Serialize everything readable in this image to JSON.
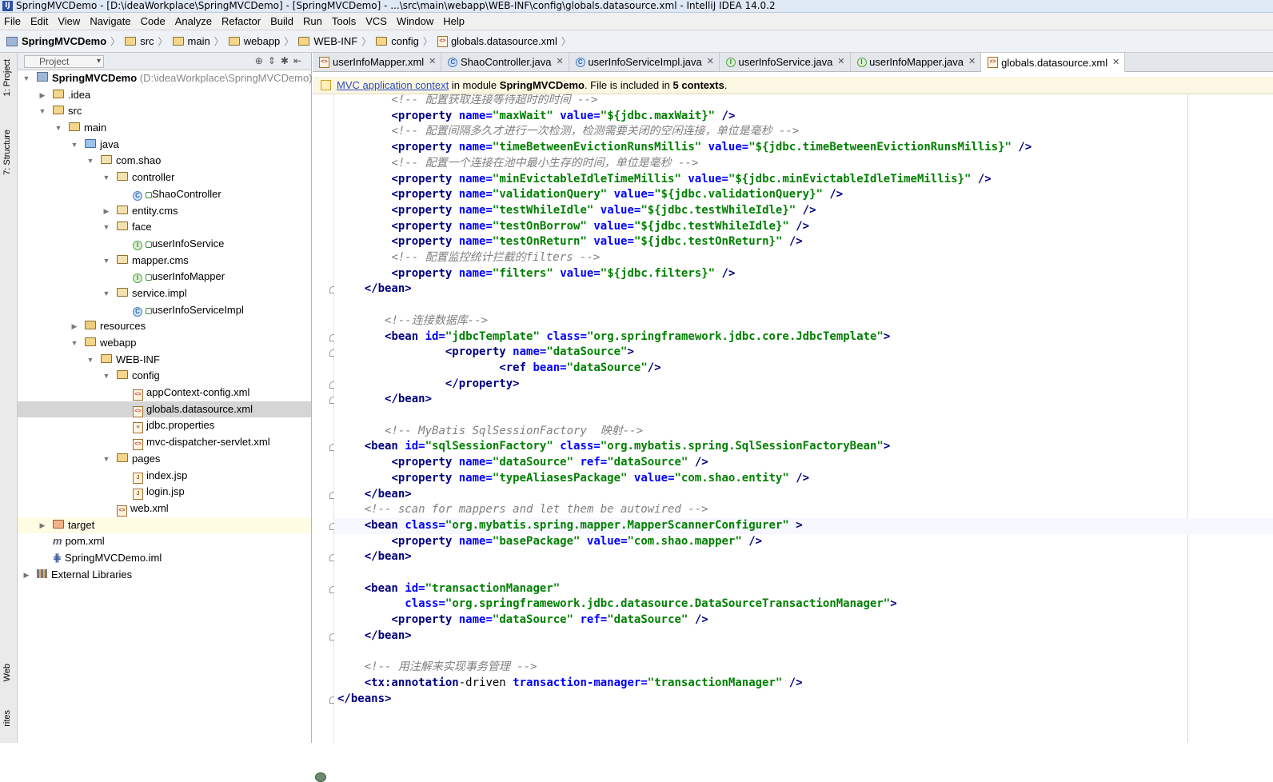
{
  "window": {
    "title": "SpringMVCDemo - [D:\\ideaWorkplace\\SpringMVCDemo] - [SpringMVCDemo] - ...\\src\\main\\webapp\\WEB-INF\\config\\globals.datasource.xml - IntelliJ IDEA 14.0.2"
  },
  "menu": [
    "File",
    "Edit",
    "View",
    "Navigate",
    "Code",
    "Analyze",
    "Refactor",
    "Build",
    "Run",
    "Tools",
    "VCS",
    "Window",
    "Help"
  ],
  "breadcrumbs": [
    "SpringMVCDemo",
    "src",
    "main",
    "webapp",
    "WEB-INF",
    "config",
    "globals.datasource.xml"
  ],
  "side_tabs": {
    "project": "1: Project",
    "structure": "7: Structure",
    "web": "Web",
    "favorites": "rites"
  },
  "project_panel": {
    "selector": "Project",
    "tree": [
      {
        "label": "SpringMVCDemo",
        "path": "(D:\\ideaWorkplace\\SpringMVCDemo)",
        "icon": "project-icon"
      },
      {
        "label": ".idea",
        "icon": "folder-icon"
      },
      {
        "label": "src",
        "icon": "folder-icon"
      },
      {
        "label": "main",
        "icon": "folder-icon"
      },
      {
        "label": "java",
        "icon": "source-folder-icon"
      },
      {
        "label": "com.shao",
        "icon": "package-icon"
      },
      {
        "label": "controller",
        "icon": "package-icon"
      },
      {
        "label": "ShaoController",
        "icon": "class-icon"
      },
      {
        "label": "entity.cms",
        "icon": "package-icon"
      },
      {
        "label": "face",
        "icon": "package-icon"
      },
      {
        "label": "userInfoService",
        "icon": "interface-icon"
      },
      {
        "label": "mapper.cms",
        "icon": "package-icon"
      },
      {
        "label": "userInfoMapper",
        "icon": "interface-icon"
      },
      {
        "label": "service.impl",
        "icon": "package-icon"
      },
      {
        "label": "userInfoServiceImpl",
        "icon": "class-icon"
      },
      {
        "label": "resources",
        "icon": "resources-folder-icon"
      },
      {
        "label": "webapp",
        "icon": "web-folder-icon"
      },
      {
        "label": "WEB-INF",
        "icon": "folder-icon"
      },
      {
        "label": "config",
        "icon": "folder-icon"
      },
      {
        "label": "appContext-config.xml",
        "icon": "xml-file-icon"
      },
      {
        "label": "globals.datasource.xml",
        "icon": "xml-file-icon"
      },
      {
        "label": "jdbc.properties",
        "icon": "properties-file-icon"
      },
      {
        "label": "mvc-dispatcher-servlet.xml",
        "icon": "xml-file-icon"
      },
      {
        "label": "pages",
        "icon": "folder-icon"
      },
      {
        "label": "index.jsp",
        "icon": "jsp-file-icon"
      },
      {
        "label": "login.jsp",
        "icon": "jsp-file-icon"
      },
      {
        "label": "web.xml",
        "icon": "xml-file-icon"
      },
      {
        "label": "target",
        "icon": "excluded-folder-icon"
      },
      {
        "label": "pom.xml",
        "icon": "maven-icon"
      },
      {
        "label": "SpringMVCDemo.iml",
        "icon": "module-file-icon"
      },
      {
        "label": "External Libraries",
        "icon": "libraries-icon"
      }
    ]
  },
  "tabs": [
    {
      "label": "userInfoMapper.xml",
      "icon": "xml-file-icon"
    },
    {
      "label": "ShaoController.java",
      "icon": "class-icon"
    },
    {
      "label": "userInfoServiceImpl.java",
      "icon": "class-icon"
    },
    {
      "label": "userInfoService.java",
      "icon": "interface-icon"
    },
    {
      "label": "userInfoMapper.java",
      "icon": "interface-icon"
    },
    {
      "label": "globals.datasource.xml",
      "icon": "xml-file-icon",
      "active": true
    }
  ],
  "notice": {
    "link": "MVC application context",
    "text1": " in module ",
    "module": "SpringMVCDemo",
    "text2": ". File is included in ",
    "count": "5 contexts",
    "text3": "."
  },
  "code_lines": [
    "        <!-- 配置获取连接等待超时的时间 -->",
    "        <property name=\"maxWait\" value=\"${jdbc.maxWait}\" />",
    "        <!-- 配置间隔多久才进行一次检测，检测需要关闭的空闲连接，单位是毫秒 -->",
    "        <property name=\"timeBetweenEvictionRunsMillis\" value=\"${jdbc.timeBetweenEvictionRunsMillis}\" />",
    "        <!-- 配置一个连接在池中最小生存的时间，单位是毫秒 -->",
    "        <property name=\"minEvictableIdleTimeMillis\" value=\"${jdbc.minEvictableIdleTimeMillis}\" />",
    "        <property name=\"validationQuery\" value=\"${jdbc.validationQuery}\" />",
    "        <property name=\"testWhileIdle\" value=\"${jdbc.testWhileIdle}\" />",
    "        <property name=\"testOnBorrow\" value=\"${jdbc.testWhileIdle}\" />",
    "        <property name=\"testOnReturn\" value=\"${jdbc.testOnReturn}\" />",
    "        <!-- 配置监控统计拦截的filters -->",
    "        <property name=\"filters\" value=\"${jdbc.filters}\" />",
    "    </bean>",
    "",
    "       <!--连接数据库-->",
    "       <bean id=\"jdbcTemplate\" class=\"org.springframework.jdbc.core.JdbcTemplate\">",
    "                <property name=\"dataSource\">",
    "                        <ref bean=\"dataSource\"/>",
    "                </property>",
    "       </bean>",
    "",
    "       <!-- MyBatis SqlSessionFactory  映射-->",
    "    <bean id=\"sqlSessionFactory\" class=\"org.mybatis.spring.SqlSessionFactoryBean\">",
    "        <property name=\"dataSource\" ref=\"dataSource\" />",
    "        <property name=\"typeAliasesPackage\" value=\"com.shao.entity\" />",
    "    </bean>",
    "    <!-- scan for mappers and let them be autowired -->",
    "    <bean class=\"org.mybatis.spring.mapper.MapperScannerConfigurer\" >",
    "        <property name=\"basePackage\" value=\"com.shao.mapper\" />",
    "    </bean>",
    "",
    "    <bean id=\"transactionManager\"",
    "          class=\"org.springframework.jdbc.datasource.DataSourceTransactionManager\">",
    "        <property name=\"dataSource\" ref=\"dataSource\" />",
    "    </bean>",
    "",
    "    <!-- 用注解来实现事务管理 -->",
    "    <tx:annotation-driven transaction-manager=\"transactionManager\" />",
    "</beans>"
  ]
}
